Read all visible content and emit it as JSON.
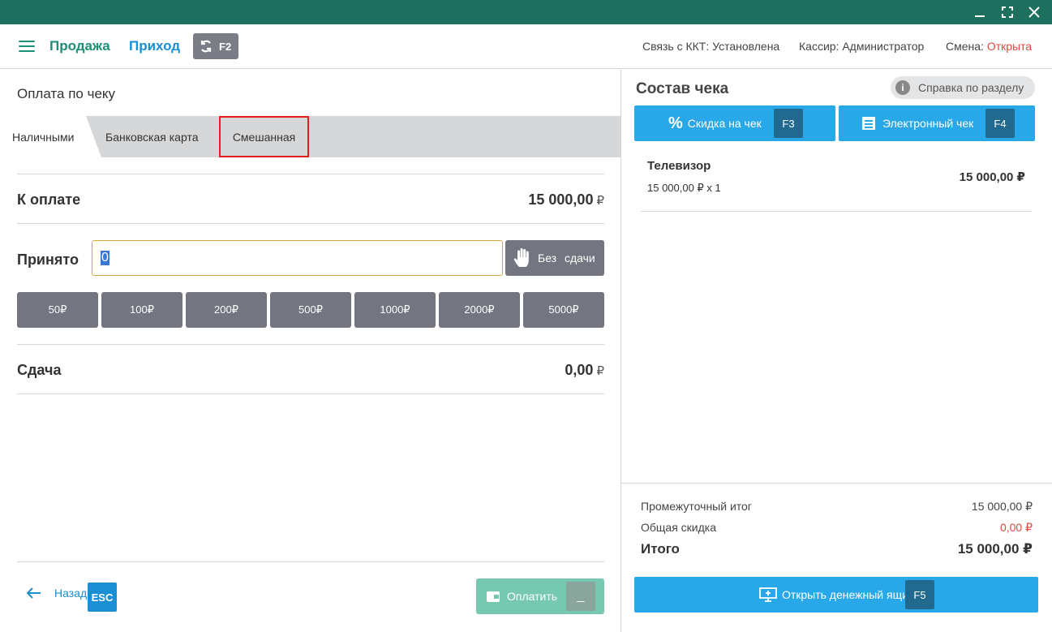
{
  "header": {
    "nav_sale": "Продажа",
    "nav_income": "Приход",
    "refresh_key": "F2",
    "status_kkt": "Связь с ККТ: Установлена",
    "status_cashier": "Кассир: Администратор",
    "status_shift_label": "Смена: ",
    "status_shift_value": "Открыта"
  },
  "payment": {
    "title": "Оплата по чеку",
    "tabs": [
      {
        "label": "Наличными",
        "active": true
      },
      {
        "label": "Банковская карта",
        "active": false
      },
      {
        "label": "Смешанная",
        "active": false,
        "highlighted": true
      }
    ],
    "to_pay_label": "К оплате",
    "to_pay_value": "15 000,00",
    "currency": "₽",
    "accepted_label": "Принято",
    "accepted_value": "0",
    "no_change_label": "Без сдачи",
    "quick_amounts": [
      "50₽",
      "100₽",
      "200₽",
      "500₽",
      "1000₽",
      "2000₽",
      "5000₽"
    ],
    "change_label": "Сдача",
    "change_value": "0,00",
    "back_label": "Назад",
    "back_key": "ESC",
    "pay_label": "Оплатить",
    "pay_key": "_"
  },
  "receipt": {
    "title": "Состав чека",
    "help_label": "Справка по разделу",
    "discount_label": "Скидка на чек",
    "discount_key": "F3",
    "echeck_label": "Электронный чек",
    "echeck_key": "F4",
    "items": [
      {
        "name": "Телевизор",
        "price_line": "15 000,00 ₽ x 1",
        "total": "15 000,00 ₽"
      }
    ],
    "subtotal_label": "Промежуточный итог",
    "subtotal_value": "15 000,00 ₽",
    "discount_total_label": "Общая скидка",
    "discount_total_value": "0,00 ₽",
    "total_label": "Итого",
    "total_value": "15 000,00 ₽",
    "drawer_label": "Открыть денежный ящик",
    "drawer_key": "F5"
  },
  "colors": {
    "titlebar": "#1d6f5e",
    "accent_green": "#1e8f76",
    "accent_blue": "#1a8fd3",
    "button_blue": "#28a8e8",
    "button_gray": "#737680",
    "alert_red": "#e2463e",
    "highlight_border": "#e0201a"
  }
}
